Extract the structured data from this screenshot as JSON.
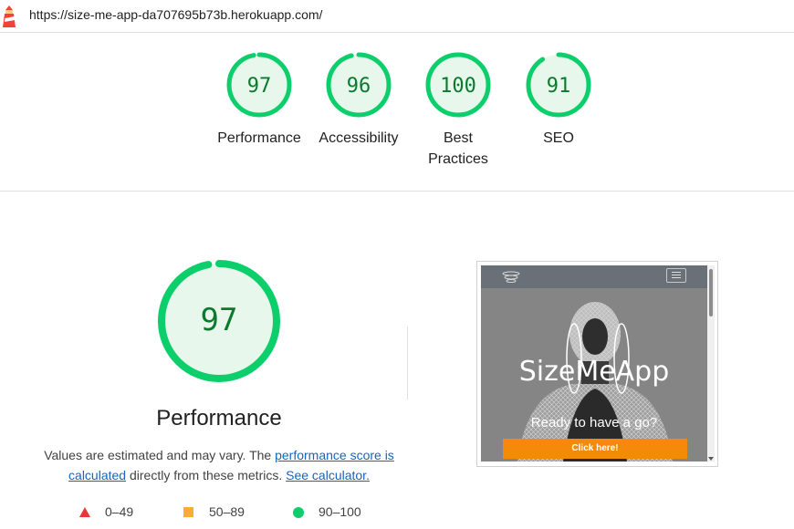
{
  "header": {
    "url": "https://size-me-app-da707695b73b.herokuapp.com/"
  },
  "gauges": [
    {
      "score": "97",
      "label": "Performance"
    },
    {
      "score": "96",
      "label": "Accessibility"
    },
    {
      "score": "100",
      "label": "Best Practices"
    },
    {
      "score": "91",
      "label": "SEO"
    }
  ],
  "main": {
    "score": "97",
    "title": "Performance",
    "desc_prefix": "Values are estimated and may vary. The ",
    "link_score": "performance score is calculated",
    "desc_middle": " directly from these metrics. ",
    "link_calc": "See calculator."
  },
  "legend": [
    {
      "range": "0–49",
      "color": "#e53935",
      "shape": "triangle"
    },
    {
      "range": "50–89",
      "color": "#fbac33",
      "shape": "square"
    },
    {
      "range": "90–100",
      "color": "#0cce6b",
      "shape": "circle"
    }
  ],
  "screenshot": {
    "app_title": "SizeMeApp",
    "tagline": "Ready to have a go?",
    "cta_label": "Click here!"
  },
  "colors": {
    "pass": "#0cce6b",
    "pass_bg": "#e7f7ec",
    "pass_text": "#0b7a2f",
    "link": "#1565c0",
    "cta": "#f58a0a"
  }
}
